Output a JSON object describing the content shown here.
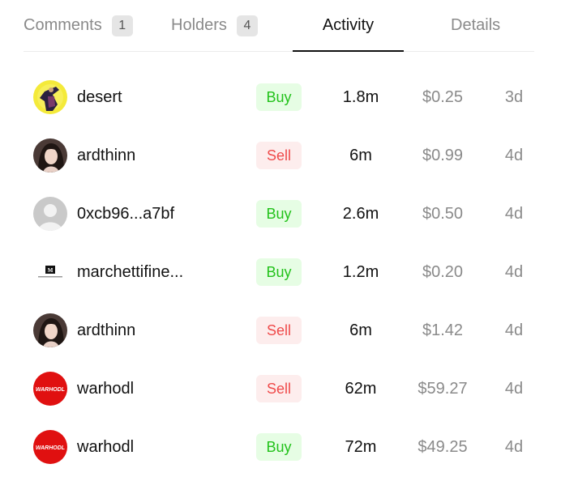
{
  "tabs": [
    {
      "label": "Comments",
      "count": "1"
    },
    {
      "label": "Holders",
      "count": "4"
    },
    {
      "label": "Activity",
      "count": null
    },
    {
      "label": "Details",
      "count": null
    }
  ],
  "active_tab": "Activity",
  "colors": {
    "buy_bg": "#e6fde4",
    "buy_text": "#22c21a",
    "sell_bg": "#fdeded",
    "sell_text": "#ef4a4a",
    "muted_text": "#8a8a8a"
  },
  "activity": [
    {
      "user": "desert",
      "avatar": "desert-avatar",
      "type": "Buy",
      "amount": "1.8m",
      "price": "$0.25",
      "age": "3d"
    },
    {
      "user": "ardthinn",
      "avatar": "portrait-avatar",
      "type": "Sell",
      "amount": "6m",
      "price": "$0.99",
      "age": "4d"
    },
    {
      "user": "0xcb96...a7bf",
      "avatar": "default-user-avatar",
      "type": "Buy",
      "amount": "2.6m",
      "price": "$0.50",
      "age": "4d"
    },
    {
      "user": "marchettifine...",
      "avatar": "brand-logo-avatar",
      "type": "Buy",
      "amount": "1.2m",
      "price": "$0.20",
      "age": "4d"
    },
    {
      "user": "ardthinn",
      "avatar": "portrait-avatar",
      "type": "Sell",
      "amount": "6m",
      "price": "$1.42",
      "age": "4d"
    },
    {
      "user": "warhodl",
      "avatar": "warhodl-logo-avatar",
      "type": "Sell",
      "amount": "62m",
      "price": "$59.27",
      "age": "4d"
    },
    {
      "user": "warhodl",
      "avatar": "warhodl-logo-avatar",
      "type": "Buy",
      "amount": "72m",
      "price": "$49.25",
      "age": "4d"
    }
  ],
  "logos": {
    "warhodl_text": "WARHODL",
    "marchetti_mark": "M"
  }
}
